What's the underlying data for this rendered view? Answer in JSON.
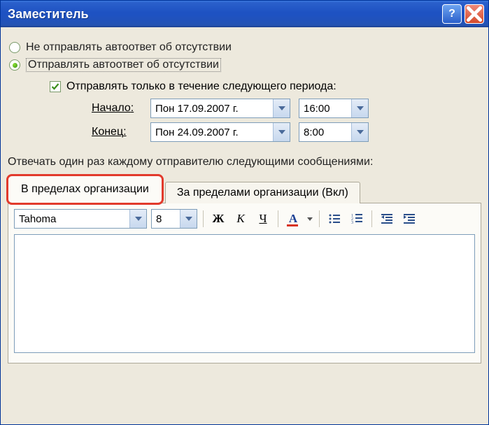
{
  "window": {
    "title": "Заместитель"
  },
  "radios": {
    "dont_send": "Не отправлять автоответ об отсутствии",
    "send": "Отправлять автоответ об отсутствии"
  },
  "checkbox_label": "Отправлять только в течение следующего периода:",
  "labels": {
    "start": "Начало",
    "end": "Конец"
  },
  "dates": {
    "start_date": "Пон 17.09.2007 г.",
    "start_time": "16:00",
    "end_date": "Пон 24.09.2007 г.",
    "end_time": "8:00"
  },
  "instruction": "Отвечать один раз каждому отправителю следующими сообщениями:",
  "tabs": {
    "inside": "В пределах организации",
    "outside": "За пределами организации (Вкл)"
  },
  "format": {
    "font": "Tahoma",
    "size": "8",
    "bold": "Ж",
    "italic": "К",
    "underline": "Ч",
    "fontcolor_glyph": "A"
  }
}
